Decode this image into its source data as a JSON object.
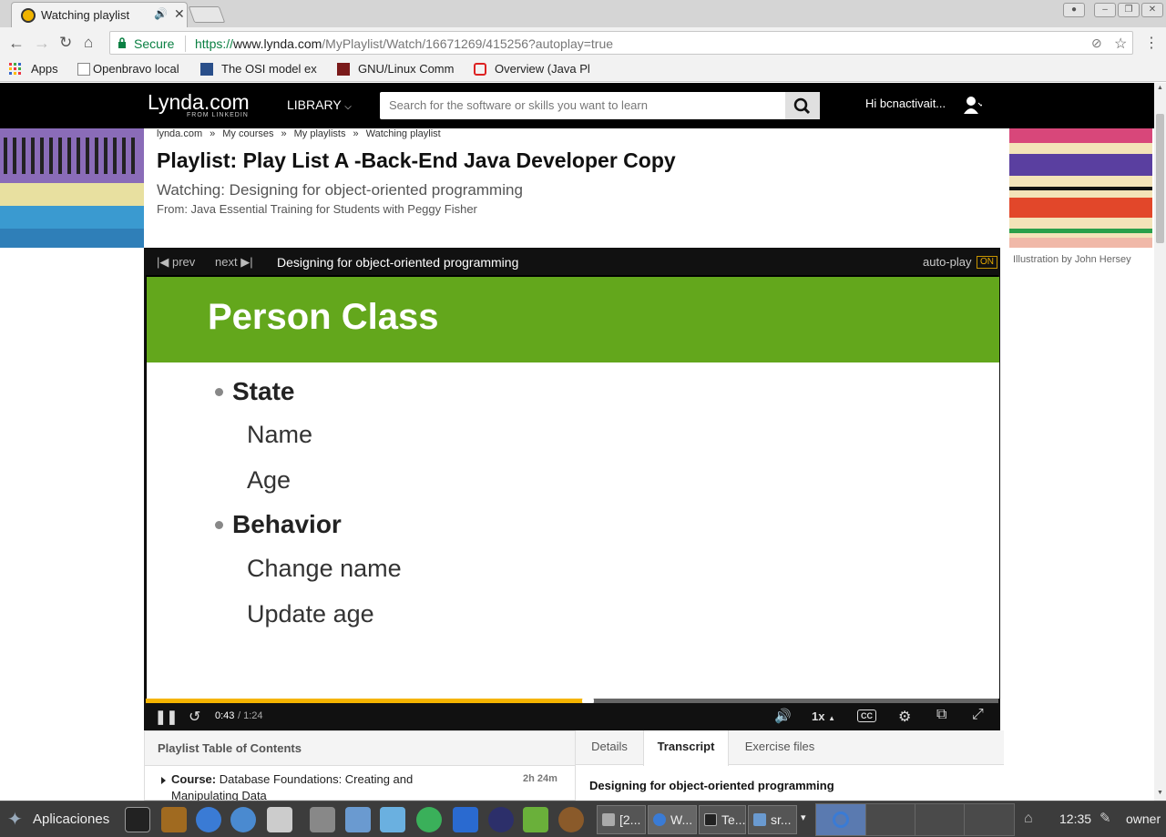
{
  "browser": {
    "tab_title": "Watching playlist",
    "url_secure_label": "Secure",
    "url_scheme": "https://",
    "url_domain": "www.lynda.com",
    "url_path": "/MyPlaylist/Watch/16671269/415256?autoplay=true",
    "bookmarks": [
      "Apps",
      "Openbravo local",
      "The OSI model ex",
      "GNU/Linux Comm",
      "Overview (Java Pl"
    ]
  },
  "site": {
    "logo": "Lynda.com",
    "logo_sub": "FROM LINKEDIN",
    "library_label": "LIBRARY",
    "search_placeholder": "Search for the software or skills you want to learn",
    "greeting": "Hi bcnactivait..."
  },
  "breadcrumb": [
    "lynda.com",
    "My courses",
    "My playlists",
    "Watching playlist"
  ],
  "breadcrumb_sep": "»",
  "page": {
    "title": "Playlist: Play List A -Back-End Java Developer Copy",
    "watching": "Watching: Designing for object-oriented programming",
    "from": "From: Java Essential Training for Students with Peggy Fisher",
    "illustration_credit": "Illustration by John Hersey"
  },
  "player": {
    "prev_label": "prev",
    "next_label": "next",
    "video_title": "Designing for object-oriented programming",
    "autoplay_label": "auto-play",
    "autoplay_state": "ON",
    "progress": 0.518,
    "time_current": "0:43",
    "time_total": "/ 1:24",
    "speed": "1x",
    "cc_label": "CC",
    "slide": {
      "title": "Person Class",
      "sections": [
        {
          "heading": "State",
          "items": [
            "Name",
            "Age"
          ]
        },
        {
          "heading": "Behavior",
          "items": [
            "Change name",
            "Update age"
          ]
        }
      ]
    }
  },
  "toc": {
    "header": "Playlist Table of Contents",
    "item_prefix": "Course:",
    "item_title": "Database Foundations: Creating and Manipulating Data",
    "item_duration": "2h 24m"
  },
  "tabs": {
    "items": [
      "Details",
      "Transcript",
      "Exercise files"
    ],
    "active": "Transcript",
    "transcript_title": "Designing for object-oriented programming"
  },
  "taskbar": {
    "start_label": "Aplicaciones",
    "windows": [
      "[2...",
      "W...",
      "Te...",
      "sr..."
    ],
    "clock": "12:35",
    "user": "owner"
  },
  "colors": {
    "accent_green": "#63a71c",
    "progress": "#f5b400",
    "secure": "#0b8043"
  }
}
